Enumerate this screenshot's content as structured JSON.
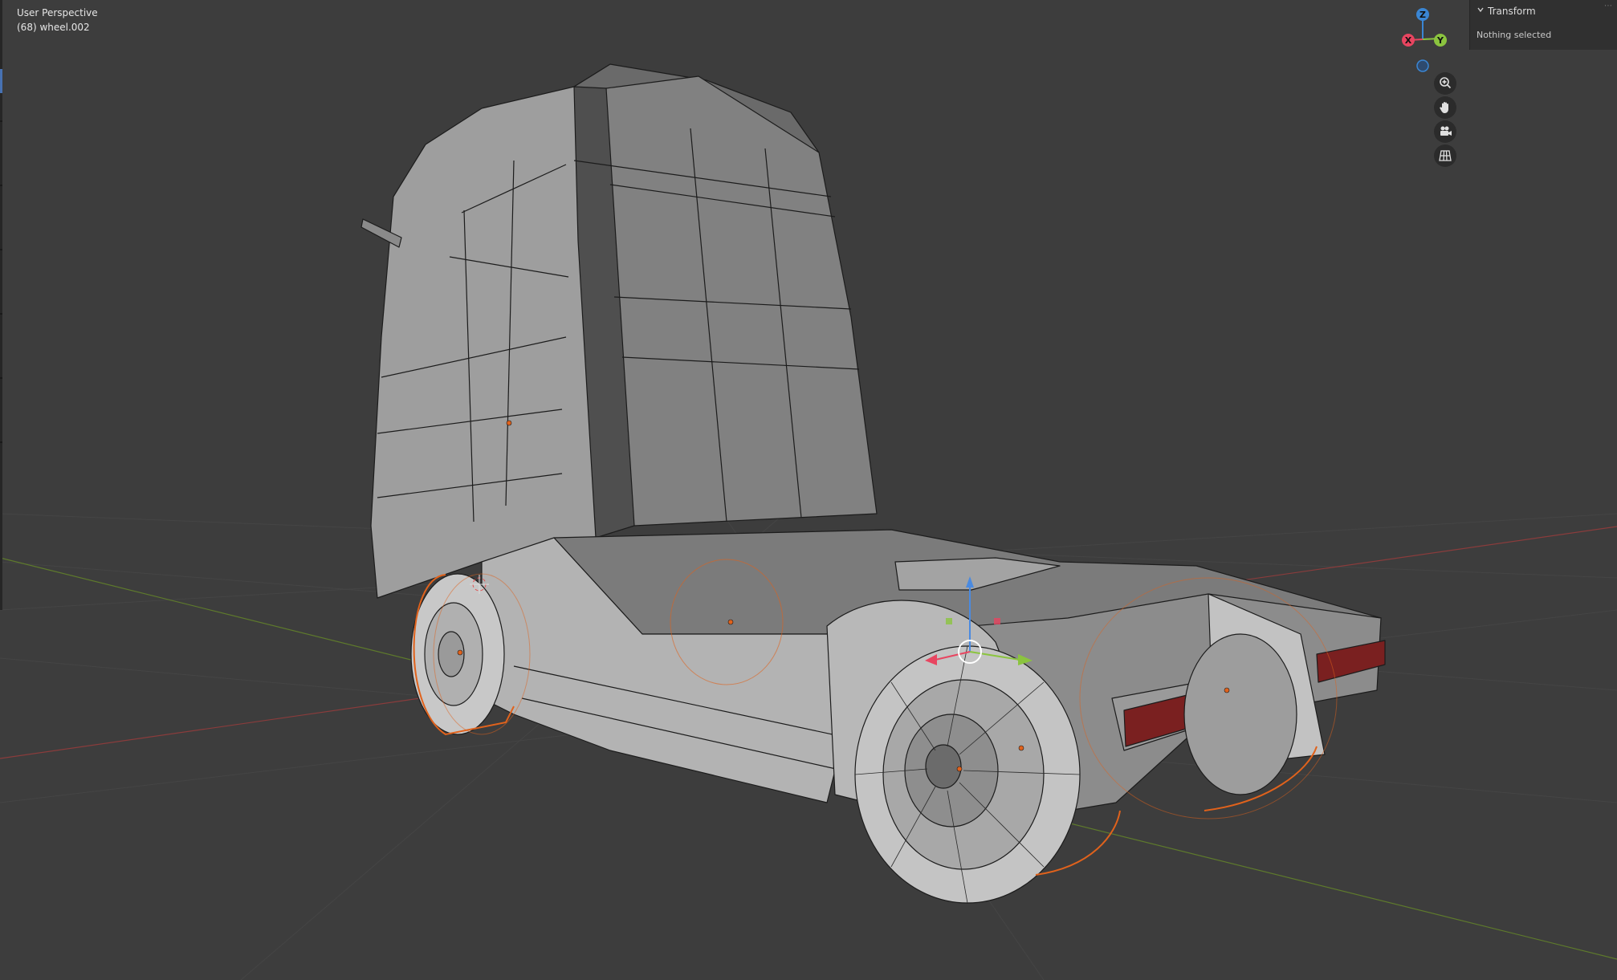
{
  "viewport": {
    "view_name": "User Perspective",
    "active_object": "(68) wheel.002"
  },
  "gizmo": {
    "z_label": "Z",
    "x_label": "X",
    "y_label": "Y",
    "colors": {
      "x": "#e84560",
      "y": "#8bc43f",
      "z": "#3a86d4"
    }
  },
  "nav_buttons": [
    {
      "icon": "zoom-icon"
    },
    {
      "icon": "hand-pan-icon"
    },
    {
      "icon": "camera-icon"
    },
    {
      "icon": "grid-ortho-icon"
    }
  ],
  "sidebar": {
    "panel_title": "Transform",
    "status": "Nothing selected"
  },
  "colors": {
    "background": "#3d3d3d",
    "mesh_face": "#9c9c9c",
    "selection_orange": "#e0621c",
    "taillight_red": "#7a2020"
  }
}
